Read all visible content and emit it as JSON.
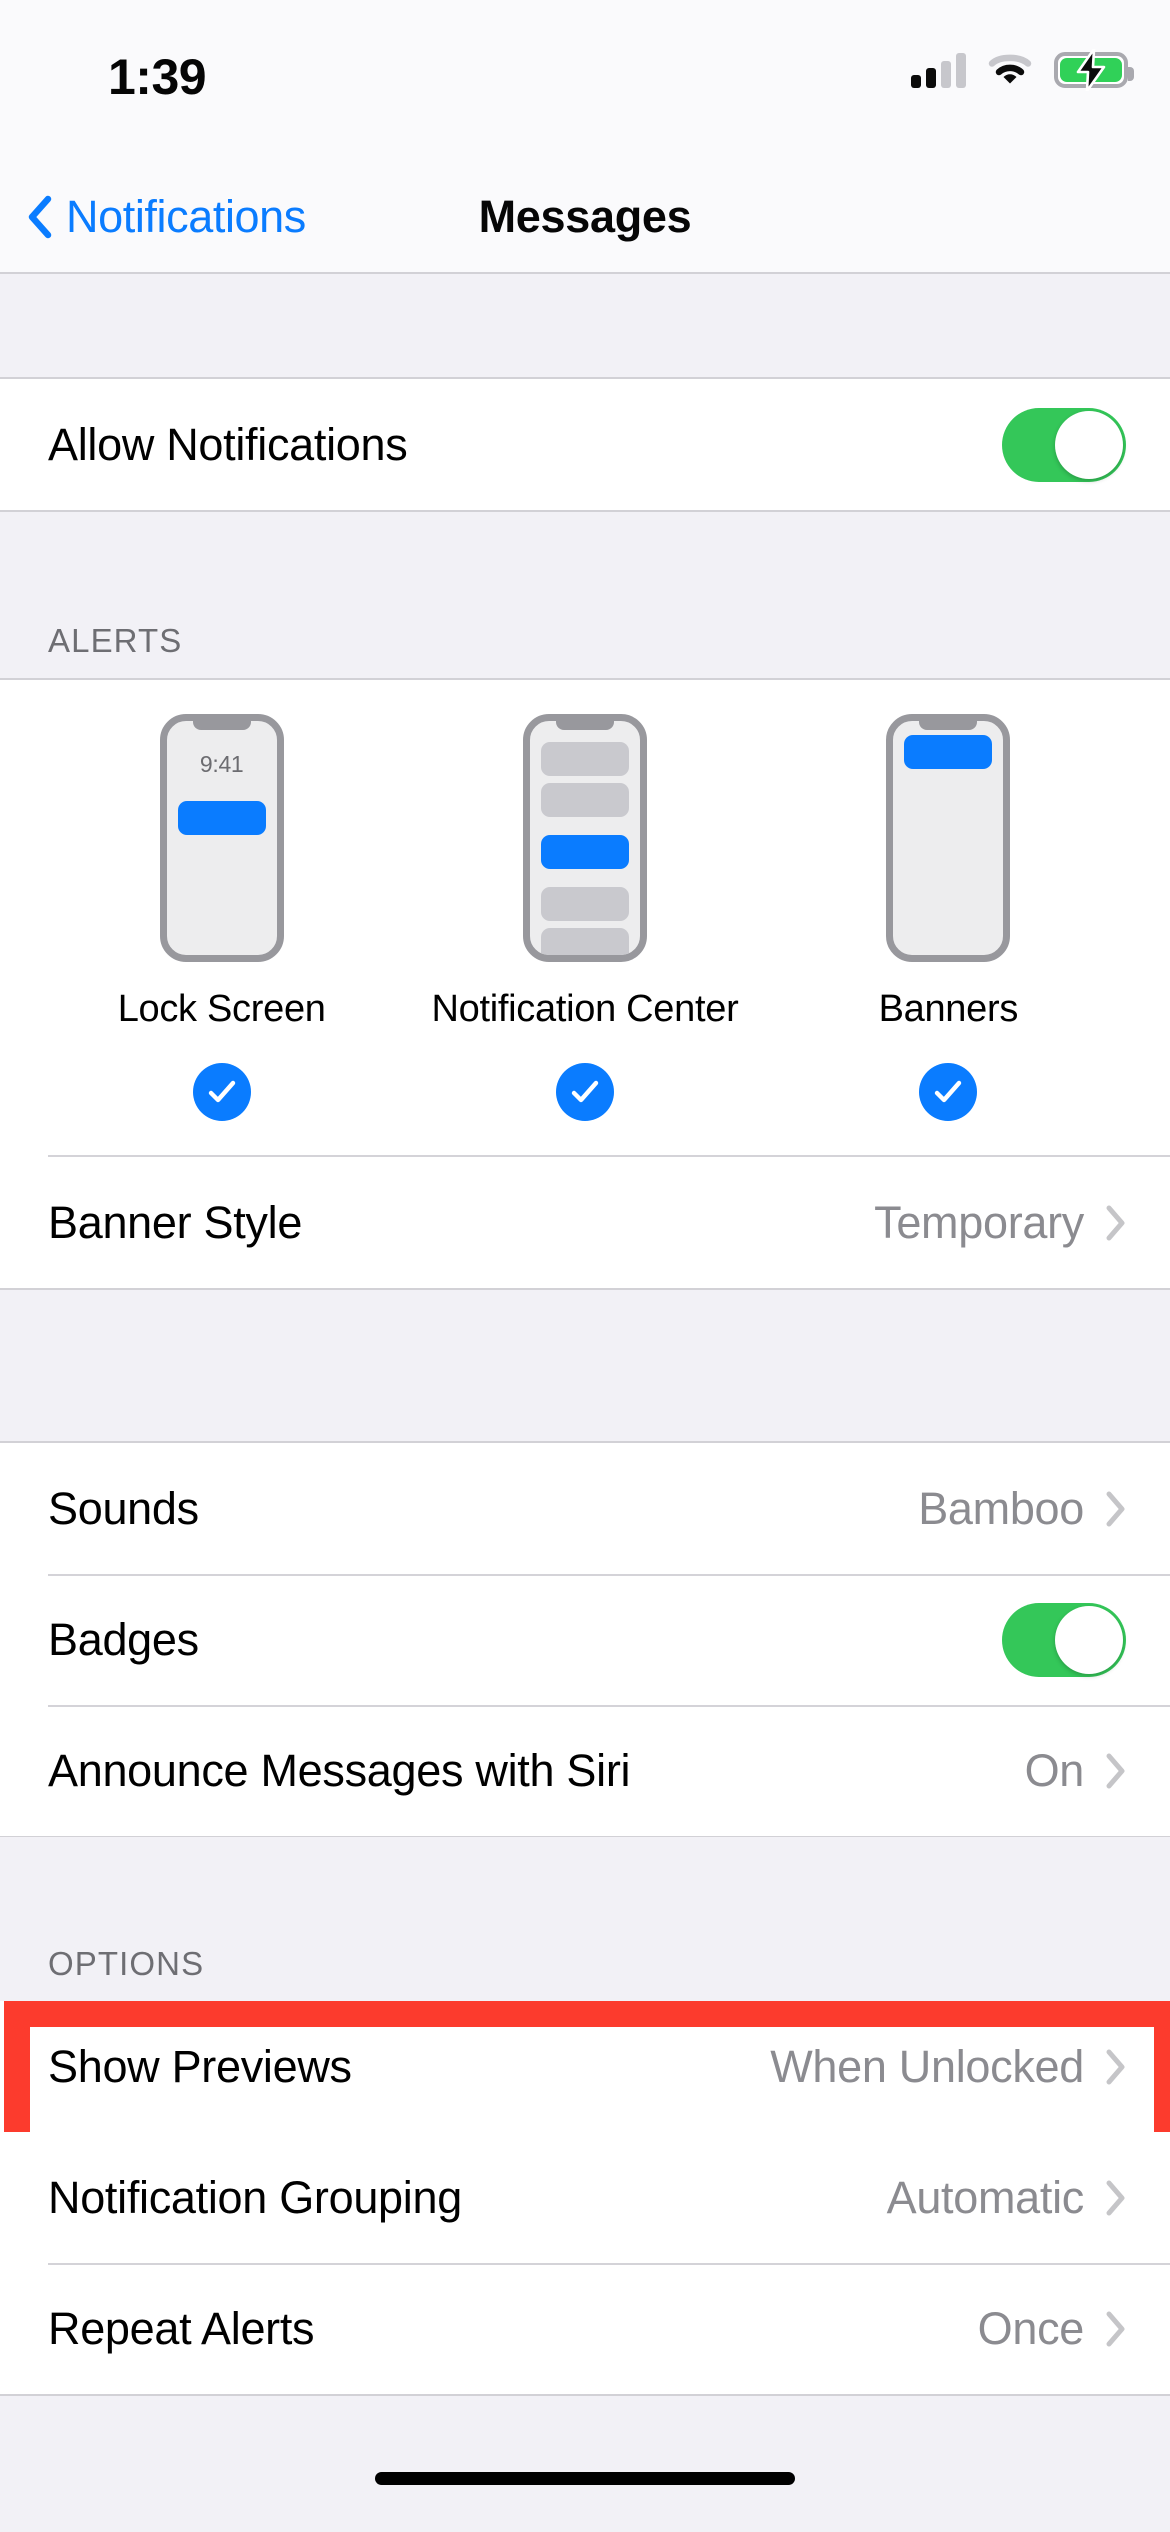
{
  "status_bar": {
    "time": "1:39",
    "icons": [
      "cellular-signal-icon",
      "wifi-icon",
      "battery-charging-icon"
    ],
    "signal_bars_filled": 2,
    "signal_bars_total": 4,
    "battery_charging": true
  },
  "nav": {
    "back_label": "Notifications",
    "title": "Messages"
  },
  "allow": {
    "label": "Allow Notifications",
    "enabled": true
  },
  "alerts": {
    "header": "ALERTS",
    "styles": [
      {
        "label": "Lock Screen",
        "checked": true,
        "preview_time": "9:41"
      },
      {
        "label": "Notification Center",
        "checked": true
      },
      {
        "label": "Banners",
        "checked": true
      }
    ],
    "banner_style": {
      "label": "Banner Style",
      "value": "Temporary"
    }
  },
  "delivery": {
    "rows": [
      {
        "label": "Sounds",
        "value": "Bamboo",
        "type": "disclosure"
      },
      {
        "label": "Badges",
        "value": "",
        "type": "toggle",
        "enabled": true
      },
      {
        "label": "Announce Messages with Siri",
        "value": "On",
        "type": "disclosure"
      }
    ]
  },
  "options": {
    "header": "OPTIONS",
    "rows": [
      {
        "label": "Show Previews",
        "value": "When Unlocked",
        "highlighted": true
      },
      {
        "label": "Notification Grouping",
        "value": "Automatic",
        "highlighted": false
      },
      {
        "label": "Repeat Alerts",
        "value": "Once",
        "highlighted": false
      }
    ]
  },
  "colors": {
    "accent_blue": "#0a7cff",
    "toggle_green": "#34c759",
    "highlight_red": "#fc3b2d",
    "group_bg": "#f2f1f6",
    "row_bg": "#ffffff",
    "secondary_text": "#8b8b90"
  }
}
